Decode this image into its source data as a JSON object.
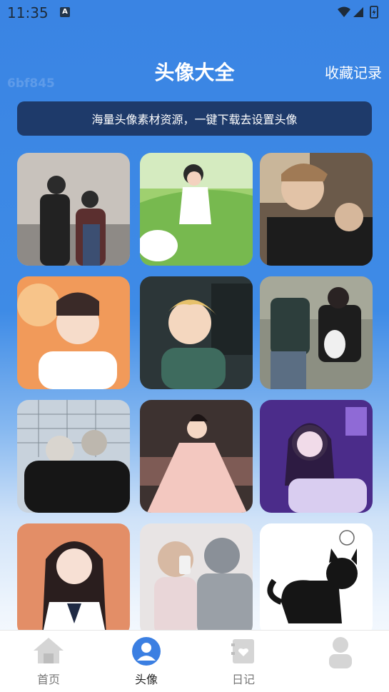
{
  "status_bar": {
    "time": "11:35",
    "notif_icon": "a-icon"
  },
  "watermark": "6bf845",
  "header": {
    "title": "头像大全",
    "favorites_label": "收藏记录"
  },
  "banner": {
    "text": "海量头像素材资源，一键下载去设置头像"
  },
  "grid": {
    "items": [
      "couple-street-photo",
      "anime-girl-running-field",
      "boy-glasses-selfie",
      "anime-boy-sunset",
      "anime-boy-blond-computer",
      "couple-sitting-bench",
      "two-girls-hugging-fence",
      "princess-dress-girl",
      "girl-neon-purple",
      "anime-girl-sailor-uniform",
      "couple-mirror-selfie",
      "black-cat-cartoon"
    ]
  },
  "tabbar": {
    "tabs": [
      {
        "label": "首页",
        "icon": "home-icon"
      },
      {
        "label": "头像",
        "icon": "avatar-icon",
        "active": true
      },
      {
        "label": "日记",
        "icon": "diary-icon"
      },
      {
        "label": "",
        "icon": "profile-icon"
      }
    ]
  },
  "colors": {
    "primary": "#3a84e3",
    "banner": "#1e3a6a",
    "tab_active": "#3b7fe2"
  }
}
